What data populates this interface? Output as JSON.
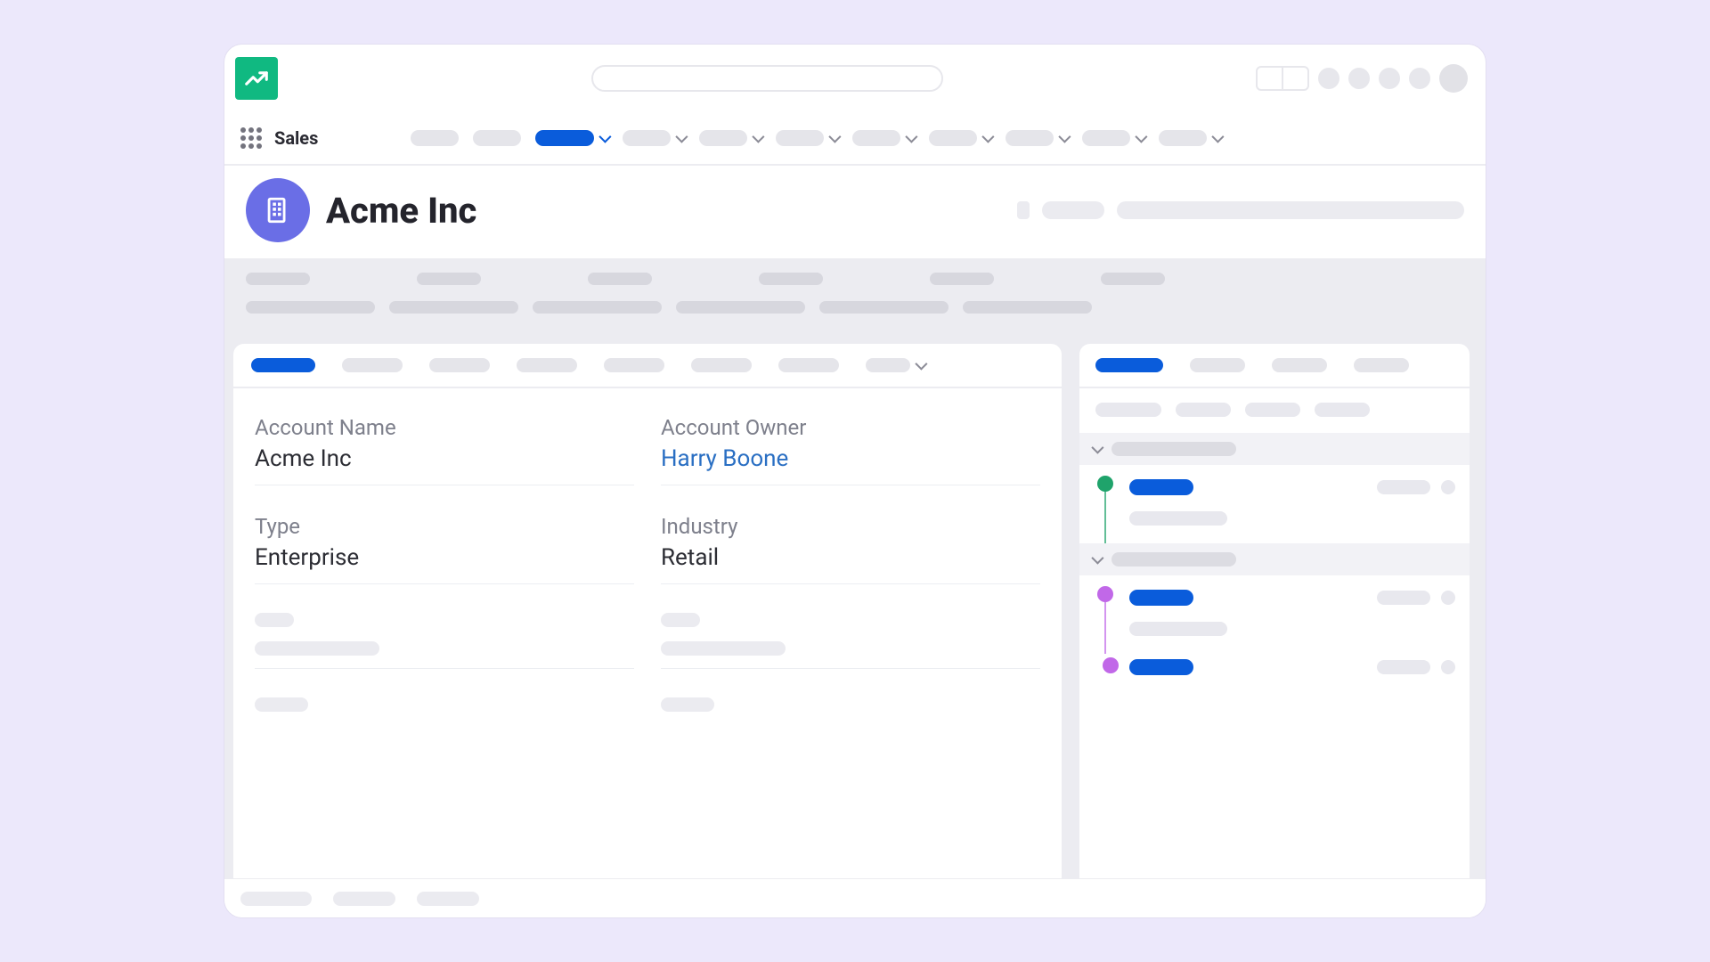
{
  "nav": {
    "app_title": "Sales"
  },
  "record": {
    "title": "Acme Inc"
  },
  "details": {
    "account_name_label": "Account Name",
    "account_name_value": "Acme Inc",
    "account_owner_label": "Account Owner",
    "account_owner_value": "Harry Boone",
    "type_label": "Type",
    "type_value": "Enterprise",
    "industry_label": "Industry",
    "industry_value": "Retail"
  },
  "colors": {
    "brand_green": "#10b981",
    "primary_blue": "#0a5cdb",
    "record_icon_bg": "#6a6ee6",
    "timeline_green": "#1fa36b",
    "timeline_purple": "#c168e8"
  }
}
